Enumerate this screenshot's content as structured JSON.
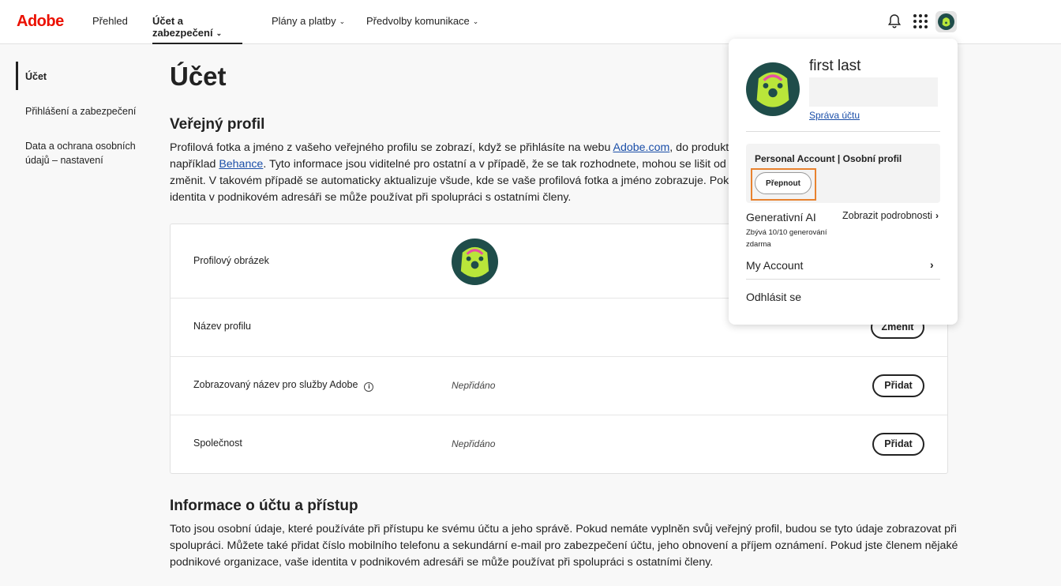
{
  "nav": {
    "logo": "Adobe",
    "items": [
      {
        "label": "Přehled",
        "has_chevron": false
      },
      {
        "label": "Účet a zabezpečení",
        "has_chevron": true
      },
      {
        "label": "Plány a platby",
        "has_chevron": true
      },
      {
        "label": "Předvolby komunikace",
        "has_chevron": true
      }
    ],
    "active": "Účet a zabezpečení",
    "icons": [
      "bell-icon",
      "apps-grid-icon",
      "avatar"
    ]
  },
  "sidebar": {
    "items": [
      {
        "label": "Účet"
      },
      {
        "label": "Přihlášení a zabezpečení"
      },
      {
        "label": "Data a ochrana osobních údajů – nastavení"
      }
    ]
  },
  "main": {
    "title": "Účet",
    "public_profile": {
      "heading": "Veřejný profil",
      "text_before_link1": "Profilová fotka a jméno z vašeho veřejného profilu se zobrazí, když se přihlásíte na webu ",
      "link1": "Adobe.com",
      "text_after_link1": ", do produktů a služe",
      "line2_before_link": "například ",
      "link2": "Behance",
      "line2_after_link": ". Tyto informace jsou viditelné pro ostatní a v případě, že se tak rozhodnete, mohou se lišit od názvu va",
      "line3": "změnit. V takovém případě se automaticky aktualizuje všude, kde se vaše profilová fotka a jméno zobrazuje. Pokud jste čle",
      "line4": "identita v podnikovém adresáři se může používat při spolupráci s ostatními členy."
    },
    "rows": [
      {
        "label": "Profilový obrázek",
        "value": "",
        "button": ""
      },
      {
        "label": "Název profilu",
        "value": "",
        "button": "Změnit"
      },
      {
        "label": "Zobrazovaný název pro služby Adobe",
        "value": "Nepřidáno",
        "button": "Přidat"
      },
      {
        "label": "Společnost",
        "value": "Nepřidáno",
        "button": "Přidat"
      }
    ],
    "account_info": {
      "heading": "Informace o účtu a přístup",
      "line1": "Toto jsou osobní údaje, které používáte při přístupu ke svému účtu a jeho správě. Pokud nemáte vyplněn svůj veřejný profil, budou se tyto údaje zobrazovat při",
      "line2": "spolupráci. Můžete také přidat číslo mobilního telefonu a sekundární e-mail pro zabezpečení účtu, jeho obnovení a příjem oznámení. Pokud jste členem nějaké",
      "line3": "podnikové organizace, vaše identita v podnikovém adresáři se může používat při spolupráci s ostatními členy."
    }
  },
  "panel": {
    "name": "first last",
    "manage_link": "Správa účtu",
    "profile_title": "Personal Account | Osobní profil",
    "switch_button": "Přepnout",
    "gen_ai_title": "Generativní AI",
    "gen_ai_sub": "Zbývá 10/10 generování zdarma",
    "details_link": "Zobrazit podrobnosti",
    "my_account": "My Account",
    "logout": "Odhlásit se"
  },
  "colors": {
    "brand": "#eb1000",
    "link": "#1a4ea8",
    "highlight": "#e8822f",
    "avatar_bg": "#1f4d4a",
    "avatar_face": "#b9e63a"
  }
}
